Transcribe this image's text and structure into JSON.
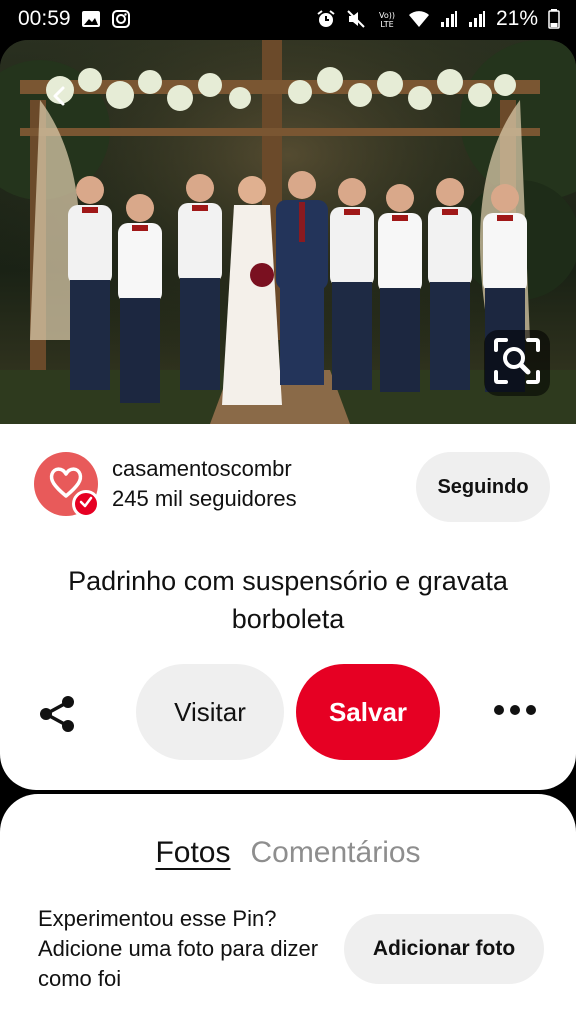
{
  "status_bar": {
    "time": "00:59",
    "network_label": "Vo)) LTE",
    "battery": "21%",
    "icons": [
      "gallery-icon",
      "instagram-icon",
      "alarm-icon",
      "mute-icon",
      "volte-icon",
      "wifi-icon",
      "signal-icon",
      "signal-icon",
      "battery-icon"
    ]
  },
  "photo": {
    "description_icon": "wedding-photo",
    "back_icon": "chevron-left-icon",
    "lens_icon": "visual-search-icon"
  },
  "creator": {
    "name": "casamentoscombr",
    "followers": "245 mil seguidores",
    "follow_label": "Seguindo",
    "avatar_color": "#e85a5a"
  },
  "pin": {
    "title": "Padrinho com suspensório e gravata borboleta"
  },
  "actions": {
    "visit_label": "Visitar",
    "save_label": "Salvar",
    "save_color": "#e60023"
  },
  "tabs": {
    "items": [
      {
        "label": "Fotos",
        "active": true
      },
      {
        "label": "Comentários",
        "active": false
      }
    ]
  },
  "tried_it": {
    "text": "Experimentou esse Pin? Adicione uma foto para dizer como foi",
    "button_label": "Adicionar foto"
  }
}
